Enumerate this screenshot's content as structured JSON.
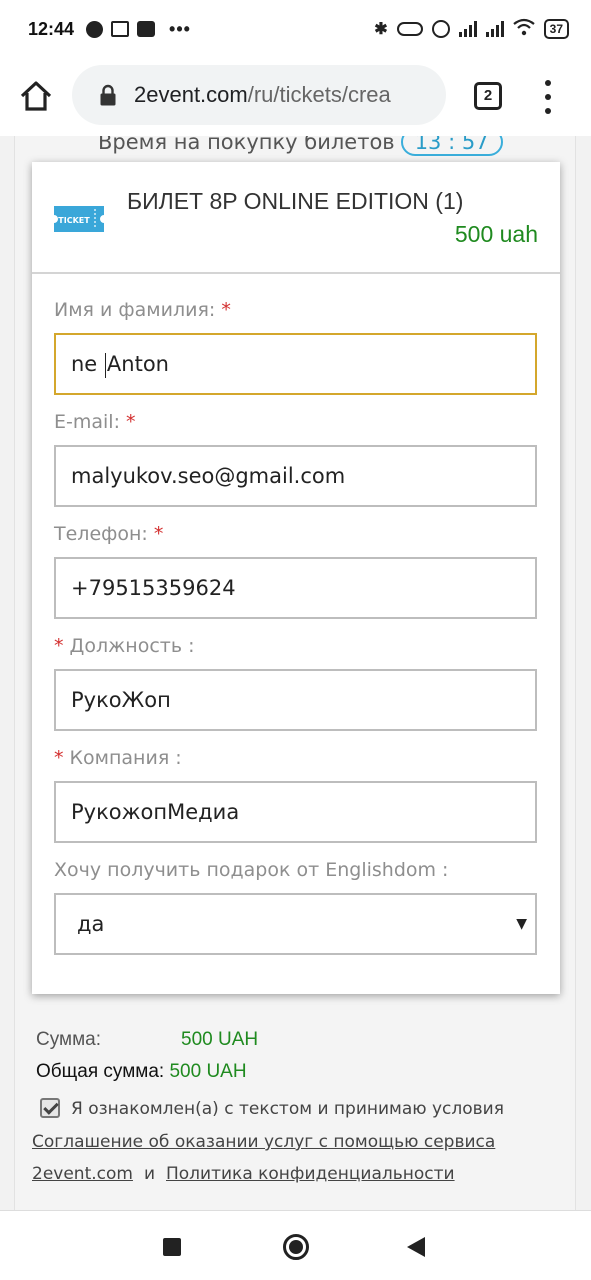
{
  "status_bar": {
    "time": "12:44",
    "battery": "37",
    "left_icons": [
      "notification-icon",
      "mail-icon",
      "youtube-icon"
    ],
    "overflow": "•••",
    "right_icons": [
      "bluetooth-icon",
      "vibrate-icon",
      "alarm-icon",
      "signal-icon",
      "signal-icon",
      "wifi-icon",
      "battery-icon"
    ]
  },
  "browser": {
    "url_host": "2event.com",
    "url_path": "/ru/tickets/crea",
    "tab_count": "2"
  },
  "page": {
    "timer_label": "Время на покупку билетов",
    "timer_value": "13 : 57",
    "ticket": {
      "icon_text": "TICKET",
      "title": "БИЛЕТ 8P ONLINE EDITION (1)",
      "price": "500 uah"
    },
    "fields": {
      "name": {
        "label": "Имя и фамилия: ",
        "required_mark": "*",
        "value_before_caret": "ne ",
        "value_after_caret": "Anton"
      },
      "email": {
        "label": "E-mail: ",
        "required_mark": "*",
        "value": "malyukov.seo@gmail.com"
      },
      "phone": {
        "label": "Телефон: ",
        "required_mark": "*",
        "value": "+79515359624"
      },
      "position": {
        "required_mark": "* ",
        "label": "Должность :",
        "value": "РукоЖоп"
      },
      "company": {
        "required_mark": "* ",
        "label": "Компания :",
        "value": "РукожопМедиа"
      },
      "gift": {
        "label": "Хочу получить подарок от Englishdom :",
        "value": "да",
        "arrow": "▼"
      }
    },
    "summary": {
      "sum_label": "Сумма:",
      "sum_value": "500 UAH",
      "total_label": "Общая сумма: ",
      "total_value": "500 UAH"
    },
    "agreement": {
      "checked": true,
      "text": "Я ознакомлен(а) с текстом и принимаю условия",
      "link1_line1": "Соглашение об оказании услуг с помощью сервиса",
      "link1_line2": "2event.com",
      "and": "и",
      "link2": "Политика конфиденциальности"
    }
  },
  "colors": {
    "price_green": "#1f8a1f",
    "required_red": "#d32f2f",
    "focus_border": "#d4a72c",
    "timer_blue": "#2a9cc8"
  }
}
